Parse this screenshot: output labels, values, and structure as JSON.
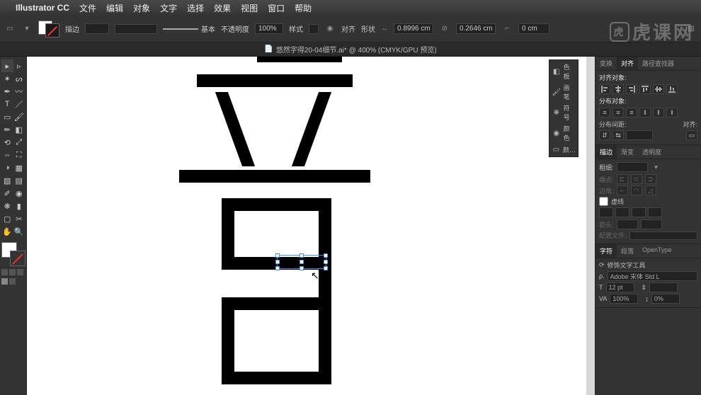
{
  "mac_menu": {
    "apple": "",
    "app": "Illustrator CC",
    "items": [
      "文件",
      "编辑",
      "对象",
      "文字",
      "选择",
      "效果",
      "视图",
      "窗口",
      "帮助"
    ]
  },
  "control_bar": {
    "stroke_label": "描边",
    "stroke_pt": "",
    "style_basic": "基本",
    "opacity_label": "不透明度",
    "opacity_value": "100%",
    "style_label": "样式",
    "align_label": "对齐",
    "shape_label": "形状",
    "w_value": "0.8996 cm",
    "h_value": "0.2646 cm",
    "r_value": "0 cm"
  },
  "doc_tab": {
    "icon": "📄",
    "name": "悠然字得20-04细节.ai* @ 400% (CMYK/GPU 预览)"
  },
  "mini_panel": {
    "items": [
      {
        "icon": "◧",
        "label": "色板"
      },
      {
        "icon": "🖌",
        "label": "画笔"
      },
      {
        "icon": "❋",
        "label": "符号"
      },
      {
        "icon": "◉",
        "label": "颜色"
      },
      {
        "icon": "▭",
        "label": "颜…"
      }
    ]
  },
  "right": {
    "toptabs": [
      "变换",
      "对齐",
      "路径查找器"
    ],
    "align": {
      "title_obj": "对齐对象:",
      "title_dist": "分布对象:",
      "title_space": "分布间距:",
      "align_to": "对齐:"
    },
    "stroke_tabs": [
      "描边",
      "渐变",
      "透明度"
    ],
    "stroke": {
      "weight_label": "粗细:",
      "weight_val": ""
    },
    "dash": {
      "title": "虚线",
      "label": "虚线"
    },
    "char_tabs": [
      "字符",
      "段落",
      "OpenType"
    ],
    "char": {
      "touch_tool": "修饰文字工具",
      "font": "Adobe 宋体 Std L",
      "size_label": "T",
      "size_val": "12 pt",
      "leading_val": "",
      "tracking_val": "100%",
      "baseline_val": "0%"
    }
  },
  "watermark": "虎课网"
}
